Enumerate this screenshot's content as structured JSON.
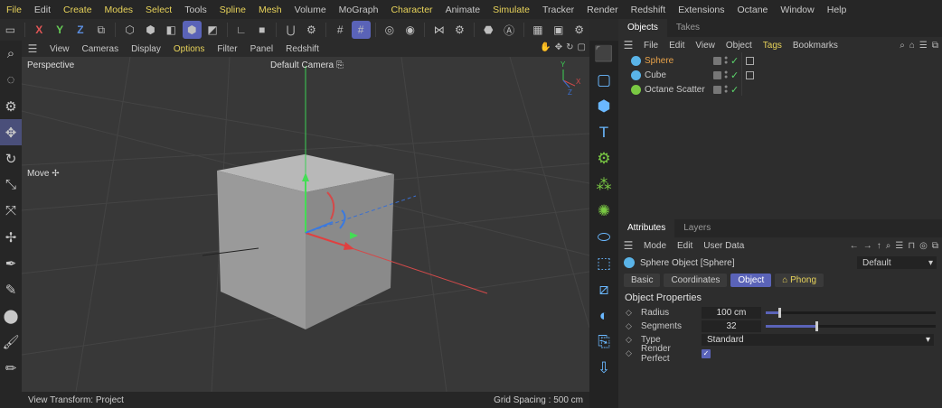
{
  "menubar": {
    "items": [
      {
        "label": "File",
        "hl": true
      },
      {
        "label": "Edit",
        "hl": false
      },
      {
        "label": "Create",
        "hl": true
      },
      {
        "label": "Modes",
        "hl": true
      },
      {
        "label": "Select",
        "hl": true
      },
      {
        "label": "Tools",
        "hl": false
      },
      {
        "label": "Spline",
        "hl": true
      },
      {
        "label": "Mesh",
        "hl": true
      },
      {
        "label": "Volume",
        "hl": false
      },
      {
        "label": "MoGraph",
        "hl": false
      },
      {
        "label": "Character",
        "hl": true
      },
      {
        "label": "Animate",
        "hl": false
      },
      {
        "label": "Simulate",
        "hl": true
      },
      {
        "label": "Tracker",
        "hl": false
      },
      {
        "label": "Render",
        "hl": false
      },
      {
        "label": "Redshift",
        "hl": false
      },
      {
        "label": "Extensions",
        "hl": false
      },
      {
        "label": "Octane",
        "hl": false
      },
      {
        "label": "Window",
        "hl": false
      },
      {
        "label": "Help",
        "hl": false
      }
    ]
  },
  "toolbar": {
    "axis_x": "X",
    "axis_y": "Y",
    "axis_z": "Z"
  },
  "viewport_menu": {
    "items": [
      {
        "label": "View",
        "hl": false
      },
      {
        "label": "Cameras",
        "hl": false
      },
      {
        "label": "Display",
        "hl": false
      },
      {
        "label": "Options",
        "hl": true
      },
      {
        "label": "Filter",
        "hl": false
      },
      {
        "label": "Panel",
        "hl": false
      },
      {
        "label": "Redshift",
        "hl": false
      }
    ]
  },
  "viewport": {
    "label": "Perspective",
    "camera": "Default Camera",
    "tool_label": "Move",
    "gizmo_axis_y": "Y",
    "gizmo_axis_x": "X",
    "gizmo_axis_z": "Z"
  },
  "statusbar": {
    "left": "View Transform: Project",
    "right": "Grid Spacing : 500 cm"
  },
  "objects_panel": {
    "tabs": [
      "Objects",
      "Takes"
    ],
    "menu": [
      {
        "label": "File",
        "hl": false
      },
      {
        "label": "Edit",
        "hl": false
      },
      {
        "label": "View",
        "hl": false
      },
      {
        "label": "Object",
        "hl": false
      },
      {
        "label": "Tags",
        "hl": true
      },
      {
        "label": "Bookmarks",
        "hl": false
      }
    ],
    "objects": [
      {
        "name": "Sphere",
        "selected": true,
        "icon_color": "#5ab4e8",
        "tag": true
      },
      {
        "name": "Cube",
        "selected": false,
        "icon_color": "#5ab4e8",
        "tag": true
      },
      {
        "name": "Octane Scatter",
        "selected": false,
        "icon_color": "#7ac943",
        "tag": false
      }
    ]
  },
  "attributes_panel": {
    "tabs": [
      "Attributes",
      "Layers"
    ],
    "menu": [
      "Mode",
      "Edit",
      "User Data"
    ],
    "object_title": "Sphere Object [Sphere]",
    "mode_select": "Default",
    "prop_tabs": [
      "Basic",
      "Coordinates",
      "Object",
      "Phong"
    ],
    "section": "Object Properties",
    "props": {
      "radius_label": "Radius",
      "radius_value": "100 cm",
      "radius_fraction": 0.08,
      "segments_label": "Segments",
      "segments_value": "32",
      "segments_fraction": 0.3,
      "type_label": "Type",
      "type_value": "Standard",
      "render_perfect_label": "Render Perfect",
      "render_perfect_checked": true
    }
  },
  "colors": {
    "accent": "#5a63b8",
    "highlight_text": "#e8d35a",
    "selected_object": "#e8a24a",
    "axis_x": "#e05555",
    "axis_y": "#66cc55",
    "axis_z": "#5b8dde"
  }
}
